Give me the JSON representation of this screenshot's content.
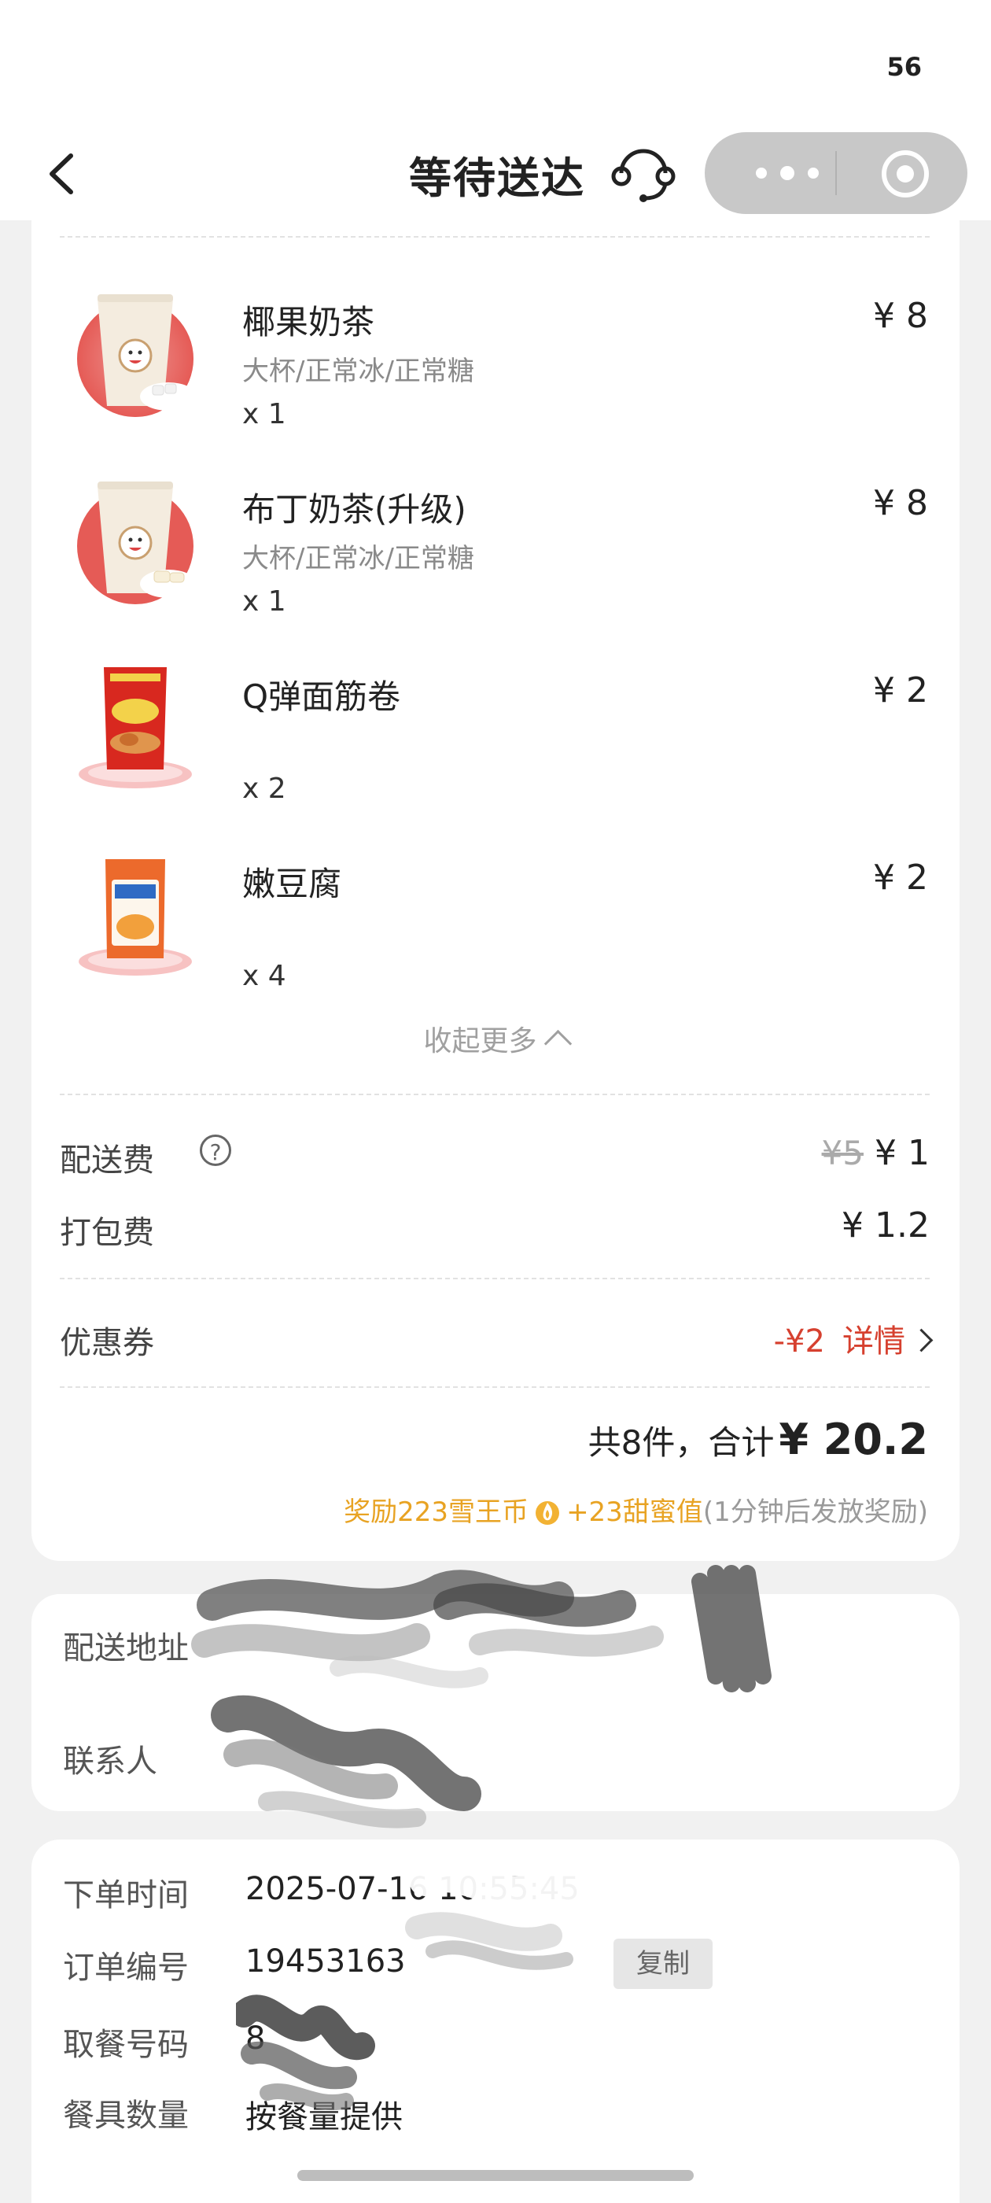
{
  "status_bar": {
    "battery": "56"
  },
  "nav": {
    "title": "等待送达"
  },
  "items": [
    {
      "name": "椰果奶茶",
      "spec": "大杯/正常冰/正常糖",
      "qty": "x 1",
      "price": "¥ 8"
    },
    {
      "name": "布丁奶茶(升级)",
      "spec": "大杯/正常冰/正常糖",
      "qty": "x 1",
      "price": "¥ 8"
    },
    {
      "name": "Q弹面筋卷",
      "spec": "",
      "qty": "x 2",
      "price": "¥ 2"
    },
    {
      "name": "嫩豆腐",
      "spec": "",
      "qty": "x 4",
      "price": "¥ 2"
    }
  ],
  "collapse_label": "收起更多",
  "fees": {
    "delivery_label": "配送费",
    "delivery_original": "¥5",
    "delivery_value": "¥ 1",
    "packing_label": "打包费",
    "packing_value": "¥ 1.2"
  },
  "coupon": {
    "label": "优惠券",
    "value": "-¥2",
    "detail": "详情"
  },
  "summary": {
    "count_text": "共8件，合计",
    "total": "¥ 20.2"
  },
  "reward": {
    "coins": "奖励223雪王币",
    "sweet": "+23甜蜜值",
    "note": "(1分钟后发放奖励)"
  },
  "delivery": {
    "address_label": "配送地址",
    "contact_label": "联系人"
  },
  "order": {
    "time_label": "下单时间",
    "time_value": "2025-07-16 10:55:45",
    "number_label": "订单编号",
    "number_value": "19453163",
    "copy_label": "复制",
    "pickup_label": "取餐号码",
    "pickup_value": "8",
    "utensils_label": "餐具数量",
    "utensils_value": "按餐量提供"
  },
  "colors": {
    "accent_red": "#d6402f",
    "reward_gold": "#e8a323",
    "background": "#f1f1f1"
  }
}
